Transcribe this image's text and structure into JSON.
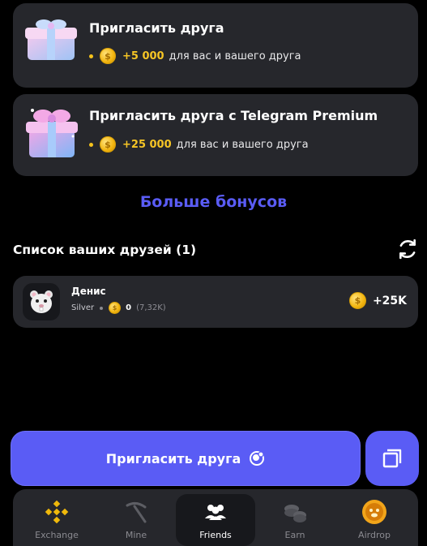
{
  "invite_cards": [
    {
      "title": "Пригласить друга",
      "reward": "+5 000",
      "suffix": "для вас и вашего друга"
    },
    {
      "title": "Пригласить друга с Telegram Premium",
      "reward": "+25 000",
      "suffix": "для вас и вашего друга"
    }
  ],
  "more_bonuses": "Больше бонусов",
  "friends": {
    "title": "Список ваших друзей (1)",
    "list": [
      {
        "name": "Денис",
        "level": "Silver",
        "coins": "0",
        "profit": "(7,32K)",
        "reward": "+25K"
      }
    ]
  },
  "actions": {
    "invite_label": "Пригласить друга"
  },
  "coin_symbol": "$",
  "colors": {
    "accent": "#5a5cf5",
    "coin_text": "#f6c525",
    "card_bg": "#26272c",
    "background": "#000000"
  },
  "nav": {
    "items": [
      {
        "label": "Exchange",
        "icon": "binance-icon",
        "active": false
      },
      {
        "label": "Mine",
        "icon": "pickaxe-icon",
        "active": false
      },
      {
        "label": "Friends",
        "icon": "friends-icon",
        "active": true
      },
      {
        "label": "Earn",
        "icon": "coins-stack-icon",
        "active": false
      },
      {
        "label": "Airdrop",
        "icon": "airdrop-coin-icon",
        "active": false
      }
    ]
  }
}
